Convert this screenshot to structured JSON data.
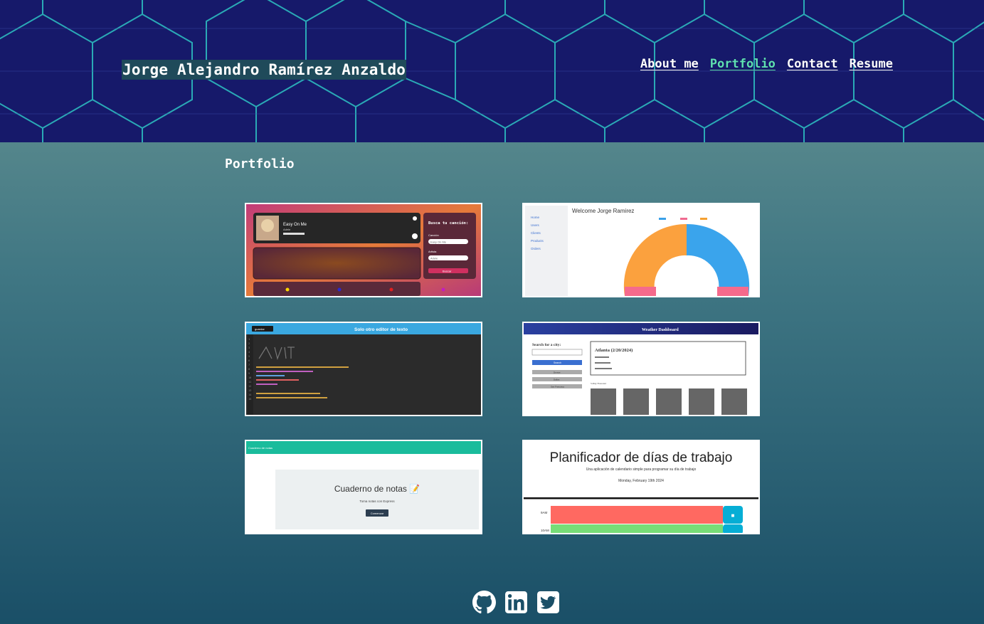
{
  "header": {
    "site_title": "Jorge Alejandro Ramírez Anzaldo",
    "nav": [
      {
        "label": "About me"
      },
      {
        "label": "Portfolio",
        "active": true
      },
      {
        "label": "Contact"
      },
      {
        "label": "Resume"
      }
    ]
  },
  "portfolio": {
    "title": "Portfolio",
    "projects": [
      {
        "song": "Easy On Me",
        "artist": "Adele",
        "form_title": "Busca tu canción:",
        "field1_label": "Canción",
        "field1_value": "Easy On Me",
        "field2_label": "Artista",
        "field2_value": "Adele",
        "button": "Buscar"
      },
      {
        "heading": "Welcome Jorge Ramirez",
        "sidebar": [
          "Home",
          "Users",
          "Clients",
          "Products",
          "Orders"
        ]
      },
      {
        "button": "guardar",
        "title": "Solo otro editor de texto"
      },
      {
        "title": "Weather Dashboard",
        "search_label": "Search for a city:",
        "button": "Search",
        "city": "Atlanta (2/20/2024)",
        "forecast_title": "5-Day Forecast:",
        "history": [
          "Denver",
          "Dallas",
          "San Francisco"
        ]
      },
      {
        "nav_title": "Cuaderno de notas",
        "title": "Cuaderno de notas 📝",
        "subtitle": "Toma notas con Express",
        "button": "Comenzar"
      },
      {
        "title": "Planificador de días de trabajo",
        "subtitle": "Una aplicación de calendario simple para programar su día de trabajo",
        "date": "Monday, February 19th 2024",
        "hours": [
          "9AM",
          "10AM"
        ]
      }
    ]
  },
  "footer": {
    "icons": [
      "github-icon",
      "linkedin-icon",
      "twitter-icon"
    ]
  },
  "colors": {
    "header_bg": "#16196a",
    "hex_lines": "#2ec4c4",
    "active_link": "#5fe0b2"
  }
}
